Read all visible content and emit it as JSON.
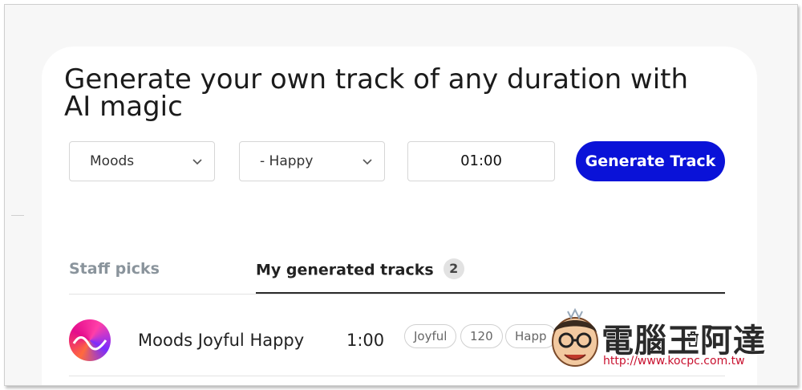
{
  "generator": {
    "headline": "Generate your own track of any duration with AI magic",
    "mood_select": {
      "value": "Moods",
      "icon": "chevron-down-icon"
    },
    "submood_select": {
      "value": "- Happy",
      "icon": "chevron-down-icon"
    },
    "duration": "01:00",
    "generate_label": "Generate Track",
    "accent_color": "#0a12d8"
  },
  "tabs": [
    {
      "label": "Staff picks",
      "active": false
    },
    {
      "label": "My generated tracks",
      "count": "2",
      "active": true
    }
  ],
  "tracks": [
    {
      "title": "Moods Joyful Happy",
      "duration": "1:00",
      "tags": [
        "Joyful",
        "120",
        "Happ"
      ],
      "actions": [
        "download-icon",
        "trash-icon"
      ]
    }
  ],
  "watermark": {
    "text": "電腦王阿達",
    "url": "http://www.kocpc.com.tw"
  }
}
